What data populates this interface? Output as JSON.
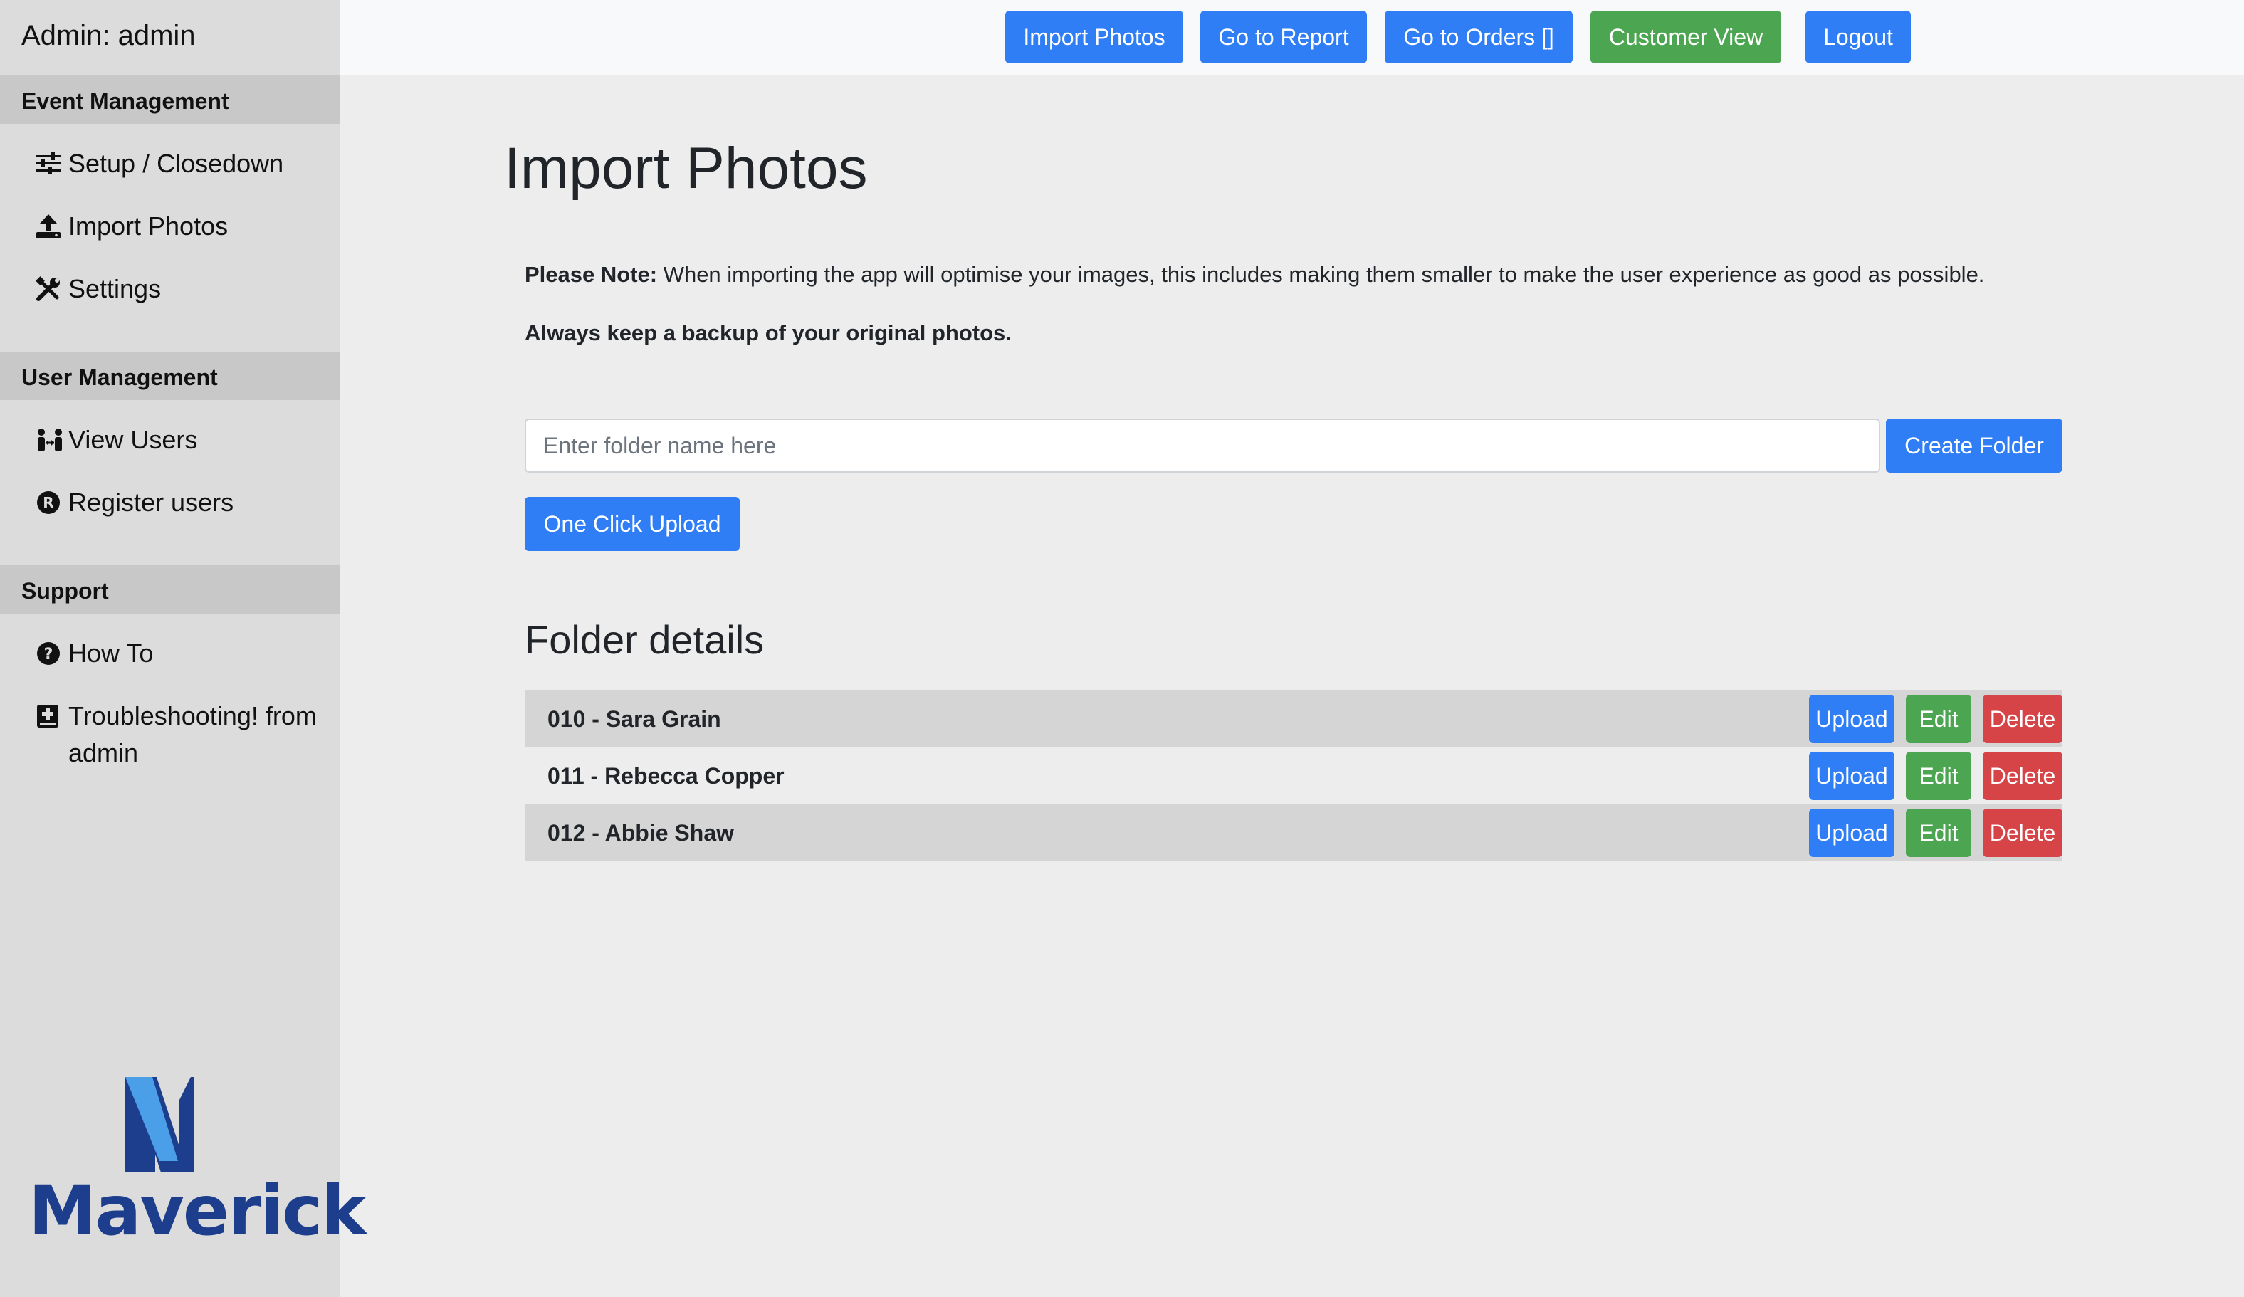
{
  "sidebar": {
    "title": "Admin: admin",
    "sections": [
      {
        "header": "Event Management",
        "items": [
          {
            "label": "Setup / Closedown",
            "icon": "sliders-icon"
          },
          {
            "label": "Import Photos",
            "icon": "upload-icon"
          },
          {
            "label": "Settings",
            "icon": "tools-icon"
          }
        ]
      },
      {
        "header": "User Management",
        "items": [
          {
            "label": "View Users",
            "icon": "users-icon"
          },
          {
            "label": "Register users",
            "icon": "registered-icon"
          }
        ]
      },
      {
        "header": "Support",
        "items": [
          {
            "label": "How To",
            "icon": "question-icon"
          },
          {
            "label": "Troubleshooting! from admin",
            "icon": "medical-book-icon"
          }
        ]
      }
    ],
    "logo": {
      "text": "Maverick",
      "color_dark": "#1d3e8c",
      "color_light": "#4a9fe8"
    }
  },
  "topbar": {
    "buttons": [
      {
        "label": "Import Photos",
        "color": "#2f7ef5"
      },
      {
        "label": "Go to Report",
        "color": "#2f7ef5"
      },
      {
        "label": "Go to Orders []",
        "color": "#2f7ef5"
      },
      {
        "label": "Customer View",
        "color": "#4ca551"
      },
      {
        "label": "Logout",
        "color": "#2f7ef5"
      }
    ]
  },
  "main": {
    "title": "Import Photos",
    "note_label": "Please Note:",
    "note_text": " When importing the app will optimise your images, this includes making them smaller to make the user experience as good as possible.",
    "backup_text": "Always keep a backup of your original photos.",
    "folder_input": {
      "placeholder": "Enter folder name here",
      "value": ""
    },
    "create_folder_label": "Create Folder",
    "one_click_upload_label": "One Click Upload",
    "folder_details_title": "Folder details",
    "folders": [
      {
        "name": "010 - Sara Grain",
        "upload": "Upload",
        "edit": "Edit",
        "delete": "Delete"
      },
      {
        "name": "011 - Rebecca Copper",
        "upload": "Upload",
        "edit": "Edit",
        "delete": "Delete"
      },
      {
        "name": "012 - Abbie Shaw",
        "upload": "Upload",
        "edit": "Edit",
        "delete": "Delete"
      }
    ]
  },
  "colors": {
    "primary": "#2f7ef5",
    "success": "#4ca551",
    "danger": "#d64447"
  }
}
